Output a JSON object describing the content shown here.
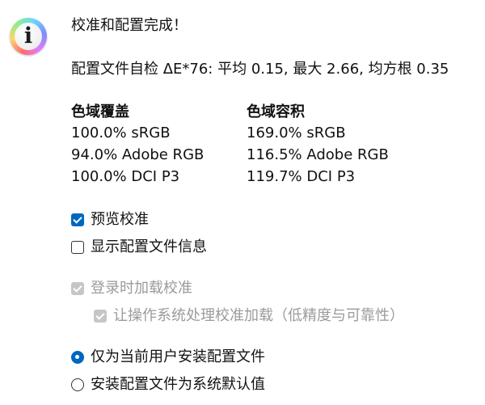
{
  "title": "校准和配置完成！",
  "summary": "配置文件自检 ΔE*76: 平均 0.15, 最大 2.66, 均方根 0.35",
  "gamut_coverage": {
    "heading": "色域覆盖",
    "lines": [
      "100.0% sRGB",
      "94.0% Adobe RGB",
      "100.0% DCI P3"
    ]
  },
  "gamut_volume": {
    "heading": "色域容积",
    "lines": [
      "169.0% sRGB",
      "116.5% Adobe RGB",
      "119.7% DCI P3"
    ]
  },
  "options": {
    "preview_calibration": {
      "label": "预览校准",
      "checked": true,
      "enabled": true
    },
    "show_profile_info": {
      "label": "显示配置文件信息",
      "checked": false,
      "enabled": true
    },
    "load_calibration_on_login": {
      "label": "登录时加载校准",
      "checked": true,
      "enabled": false
    },
    "os_handles_calibration": {
      "label": "让操作系统处理校准加载（低精度与可靠性）",
      "checked": true,
      "enabled": false
    }
  },
  "install_scope": {
    "selected": "current_user",
    "choices": [
      {
        "key": "current_user",
        "label": "仅为当前用户安装配置文件"
      },
      {
        "key": "system_default",
        "label": "安装配置文件为系统默认值"
      }
    ]
  },
  "colors": {
    "accent": "#0067c0",
    "disabled_control": "#c6c6c6",
    "disabled_text": "#9b9b9b"
  },
  "icons": {
    "dialog_icon": "info-icon"
  }
}
